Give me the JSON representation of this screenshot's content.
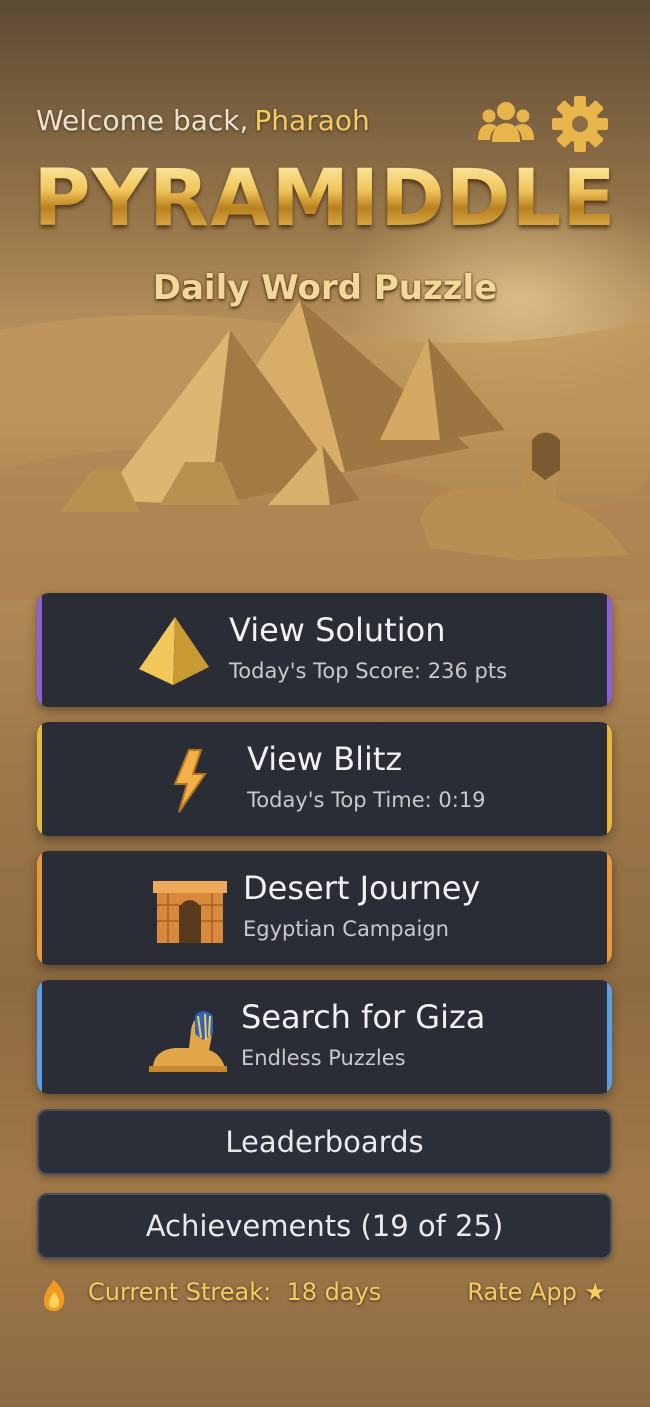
{
  "header": {
    "welcome_text": "Welcome back,",
    "user_name": "Pharaoh",
    "friends_icon": "friends-icon",
    "settings_icon": "gear-icon"
  },
  "logo": {
    "title": "PYRAMIDDLE",
    "subtitle": "Daily Word Puzzle"
  },
  "modes": [
    {
      "title": "View Solution",
      "subtitle": "Today's Top Score: 236 pts",
      "icon": "pyramid-icon",
      "accent": "#8e5fd6"
    },
    {
      "title": "View Blitz",
      "subtitle": "Today's Top Time: 0:19",
      "icon": "lightning-icon",
      "accent": "#e8b83a"
    },
    {
      "title": "Desert Journey",
      "subtitle": "Egyptian Campaign",
      "icon": "temple-gate-icon",
      "accent": "#e89a3a"
    },
    {
      "title": "Search for Giza",
      "subtitle": "Endless Puzzles",
      "icon": "sphinx-icon",
      "accent": "#5aa0e6"
    }
  ],
  "buttons": {
    "leaderboards": "Leaderboards",
    "achievements": "Achievements (19 of 25)"
  },
  "footer": {
    "streak_label": "Current Streak:",
    "streak_value": "18 days",
    "rate_label": "Rate App ★",
    "flame_icon": "flame-icon"
  },
  "colors": {
    "gold": "#f6cd62",
    "card_bg": "#2b2d36"
  }
}
